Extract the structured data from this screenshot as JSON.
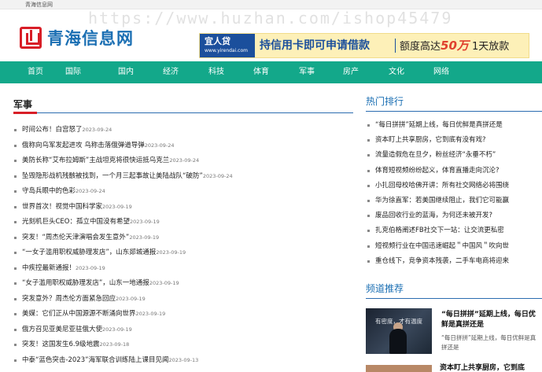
{
  "topbar": {
    "site_name": "青海信息网"
  },
  "watermark": "https://www.huzhan.com/ishop45479",
  "logo": {
    "text": "青海信息网"
  },
  "banner": {
    "brand": "宜人贷",
    "brand_url": "www.yirendai.com",
    "headline": "持信用卡即可申请借款",
    "amount_prefix": "额度高达",
    "amount": "50万",
    "suffix": "1天放款"
  },
  "nav": [
    "首页",
    "国际",
    "国内",
    "经济",
    "科技",
    "体育",
    "军事",
    "房产",
    "文化",
    "网络"
  ],
  "military": {
    "title": "军事",
    "items": [
      {
        "title": "时间公布！白宫怒了",
        "date": "2023-09-24"
      },
      {
        "title": "俄称向乌军发起进攻 乌称击落俄弹道导弹",
        "date": "2023-09-24"
      },
      {
        "title": "美防长称“艾布拉姆斯”主战坦克将很快运抵乌克兰",
        "date": "2023-09-24"
      },
      {
        "title": "坠毁隐形战机残骸被找到，一个月三起事故让美陆战队“破防”",
        "date": "2023-09-24"
      },
      {
        "title": "守岛兵眼中的色彩",
        "date": "2023-09-24"
      },
      {
        "title": "世界首次！视觉中国科学家",
        "date": "2023-09-19"
      },
      {
        "title": "光刻机巨头CEO：孤立中国没有希望",
        "date": "2023-09-19"
      },
      {
        "title": "突发！“周杰伦天津演唱会发生意外”",
        "date": "2023-09-19"
      },
      {
        "title": "“一女子滥用职权威胁理发店”，山东郯城通报",
        "date": "2023-09-19"
      },
      {
        "title": "中疾控最新通报！",
        "date": "2023-09-19"
      },
      {
        "title": "“女子滥用职权威胁理发店”，山东一地通报",
        "date": "2023-09-19"
      },
      {
        "title": "突发意外？周杰伦方面紧急回应",
        "date": "2023-09-19"
      },
      {
        "title": "美媒：它们正从中国源源不断涌向世界",
        "date": "2023-09-19"
      },
      {
        "title": "俄方召见亚美尼亚驻俄大使",
        "date": "2023-09-19"
      },
      {
        "title": "突发！这国发生6.9级地震",
        "date": "2023-09-18"
      },
      {
        "title": "中泰“蓝色突击-2023”海军联合训练陆上课目见闻",
        "date": "2023-09-13"
      }
    ]
  },
  "hot": {
    "title": "热门排行",
    "items": [
      "“每日拼拼”延期上线，每日优鲜是真拼还是",
      "资本盯上共享厨房，它到底有没有戏?",
      "流量造假危在旦夕，粉丝经济“永垂不朽”",
      "体育短视频纷纷起义，体育直播走向沉沦?",
      "小扎回母校哈佛开讲：所有社交网络必将围绕",
      "华为徐直军：若美国继续阻止，我们它可能赢",
      "废品回收行业的蓝海，为何还未被开发?",
      "扎克伯格阐述FB社交下一站：让交流更私密",
      "短视频行业在中国迅速崛起＂中国风＂吹向世",
      "重仓线下，竞争资本残袭，二手车电商将迎来"
    ]
  },
  "recommend": {
    "title": "频道推荐",
    "thumb_caption": "有密度，才有温度",
    "item": {
      "headline": "“每日拼拼”延期上线，每日优鲜是真拼还是",
      "summary": "“每日拼拼”延期上线，每日优鲜是真拼还是"
    },
    "next": "资本盯上共享厨房，它到底"
  }
}
